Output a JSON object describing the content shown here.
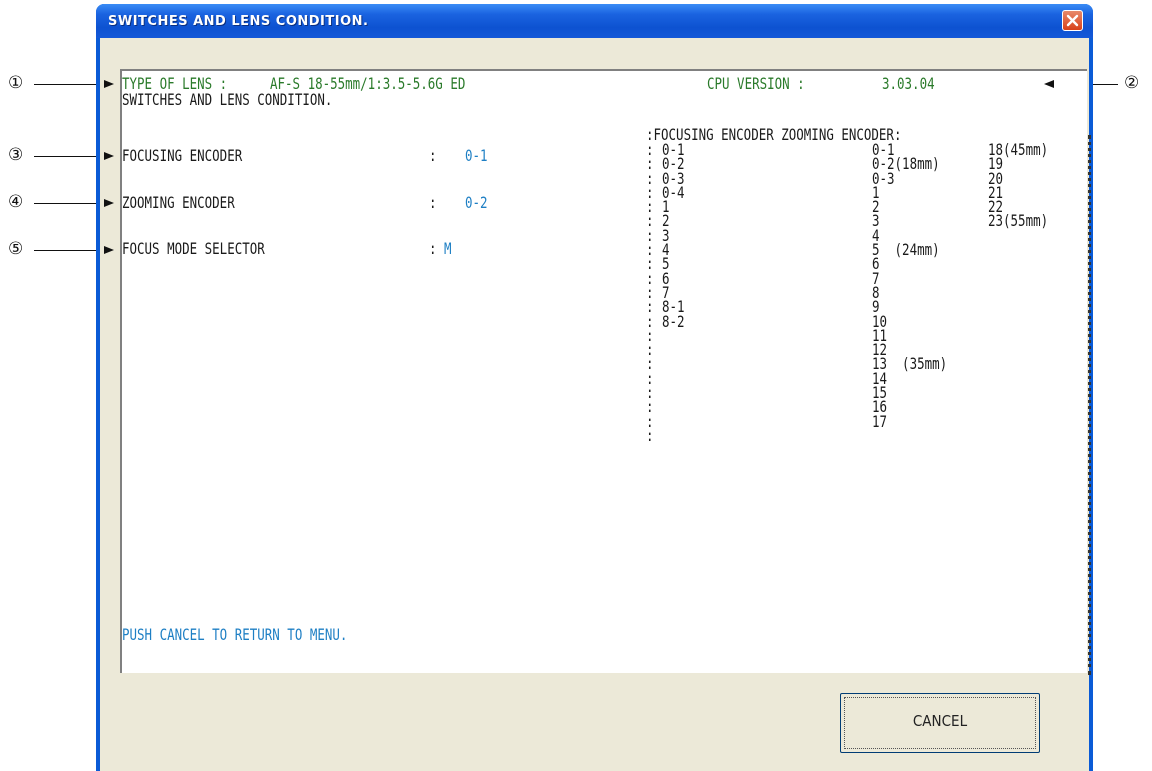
{
  "window": {
    "title": "SWITCHES AND LENS CONDITION."
  },
  "header": {
    "type_label": "TYPE OF LENS :",
    "type_value": "AF-S 18-55mm/1:3.5-5.6G ED",
    "cpu_label": "CPU VERSION :",
    "cpu_value": "3.03.04",
    "subtitle": "SWITCHES AND LENS CONDITION."
  },
  "fields": [
    {
      "label": "FOCUSING ENCODER",
      "sep": ":",
      "value": "0-1"
    },
    {
      "label": "ZOOMING ENCODER",
      "sep": ":",
      "value": "0-2"
    },
    {
      "label": "FOCUS MODE SELECTOR",
      "sep": ":",
      "value": "M"
    }
  ],
  "reference": {
    "header": ":FOCUSING ENCODER ZOOMING ENCODER:",
    "focusing": [
      "0-1",
      "0-2",
      "0-3",
      "0-4",
      "1",
      "2",
      "3",
      "4",
      "5",
      "6",
      "7",
      "8-1",
      "8-2"
    ],
    "zooming_col1": [
      "0-1",
      "0-2(18mm)",
      "0-3",
      "1",
      "2",
      "3",
      "4",
      "5  (24mm)",
      "6",
      "7",
      "8",
      "9",
      "10",
      "11",
      "12",
      "13  (35mm)",
      "14",
      "15",
      "16",
      "17"
    ],
    "zooming_col2": [
      "18(45mm)",
      "19",
      "20",
      "21",
      "22",
      "23(55mm)"
    ]
  },
  "footer": {
    "message": "PUSH CANCEL TO RETURN TO MENU."
  },
  "buttons": {
    "cancel": "CANCEL"
  },
  "callouts": [
    "①",
    "②",
    "③",
    "④",
    "⑤"
  ]
}
